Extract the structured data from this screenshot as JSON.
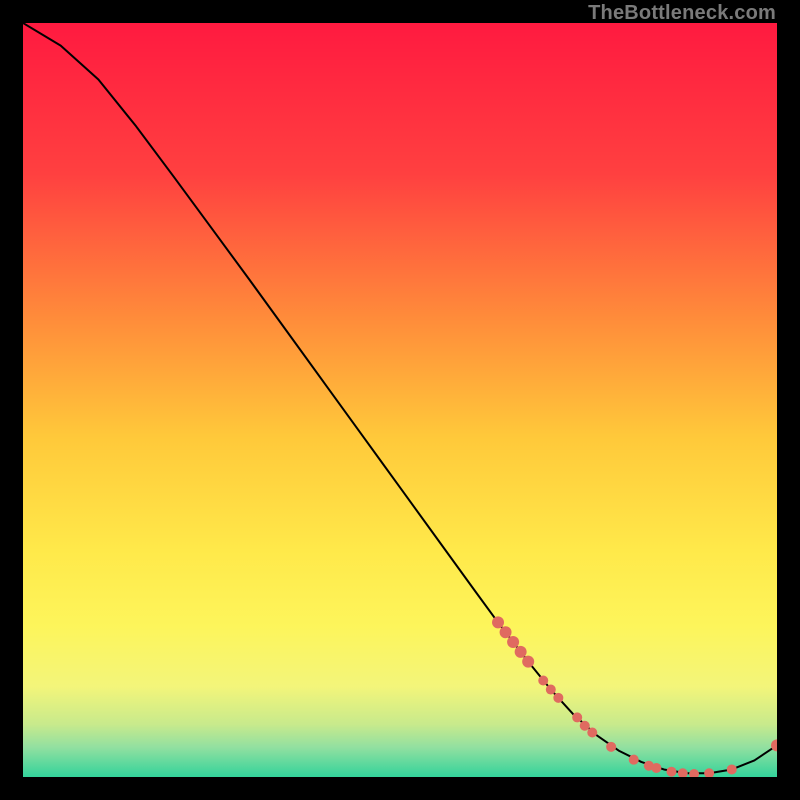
{
  "watermark": "TheBottleneck.com",
  "chart_data": {
    "type": "line",
    "title": "",
    "xlabel": "",
    "ylabel": "",
    "xlim": [
      0,
      100
    ],
    "ylim": [
      0,
      100
    ],
    "gradient_stops": [
      {
        "offset": 0,
        "color": "#ff1a40"
      },
      {
        "offset": 20,
        "color": "#ff4040"
      },
      {
        "offset": 40,
        "color": "#ff8f3a"
      },
      {
        "offset": 55,
        "color": "#ffc93a"
      },
      {
        "offset": 70,
        "color": "#ffe94a"
      },
      {
        "offset": 80,
        "color": "#fdf55b"
      },
      {
        "offset": 88,
        "color": "#f3f57a"
      },
      {
        "offset": 93,
        "color": "#c8ea8c"
      },
      {
        "offset": 96,
        "color": "#93e0a0"
      },
      {
        "offset": 100,
        "color": "#33d39b"
      }
    ],
    "series": [
      {
        "name": "bottleneck-curve",
        "x": [
          0,
          5,
          10,
          15,
          20,
          25,
          30,
          35,
          40,
          45,
          50,
          55,
          60,
          63,
          67,
          70,
          73,
          76,
          79,
          82,
          85,
          88,
          91,
          94,
          97,
          100
        ],
        "y": [
          100,
          97,
          92.5,
          86.3,
          79.6,
          72.8,
          66.0,
          59.1,
          52.2,
          45.3,
          38.4,
          31.5,
          24.6,
          20.5,
          15.3,
          11.6,
          8.3,
          5.6,
          3.5,
          2.0,
          1.0,
          0.5,
          0.5,
          1.0,
          2.2,
          4.2
        ]
      }
    ],
    "markers": {
      "name": "highlighted-points",
      "color": "#e06a60",
      "points": [
        {
          "x": 63.0,
          "y": 20.5,
          "r": 6
        },
        {
          "x": 64.0,
          "y": 19.2,
          "r": 6
        },
        {
          "x": 65.0,
          "y": 17.9,
          "r": 6
        },
        {
          "x": 66.0,
          "y": 16.6,
          "r": 6
        },
        {
          "x": 67.0,
          "y": 15.3,
          "r": 6
        },
        {
          "x": 69.0,
          "y": 12.8,
          "r": 5
        },
        {
          "x": 70.0,
          "y": 11.6,
          "r": 5
        },
        {
          "x": 71.0,
          "y": 10.5,
          "r": 5
        },
        {
          "x": 73.5,
          "y": 7.9,
          "r": 5
        },
        {
          "x": 74.5,
          "y": 6.8,
          "r": 5
        },
        {
          "x": 75.5,
          "y": 5.9,
          "r": 5
        },
        {
          "x": 78.0,
          "y": 4.0,
          "r": 5
        },
        {
          "x": 81.0,
          "y": 2.3,
          "r": 5
        },
        {
          "x": 83.0,
          "y": 1.5,
          "r": 5
        },
        {
          "x": 84.0,
          "y": 1.2,
          "r": 5
        },
        {
          "x": 86.0,
          "y": 0.7,
          "r": 5
        },
        {
          "x": 87.5,
          "y": 0.5,
          "r": 5
        },
        {
          "x": 89.0,
          "y": 0.4,
          "r": 5
        },
        {
          "x": 91.0,
          "y": 0.5,
          "r": 5
        },
        {
          "x": 94.0,
          "y": 1.0,
          "r": 5
        },
        {
          "x": 100.0,
          "y": 4.2,
          "r": 6
        }
      ]
    }
  }
}
